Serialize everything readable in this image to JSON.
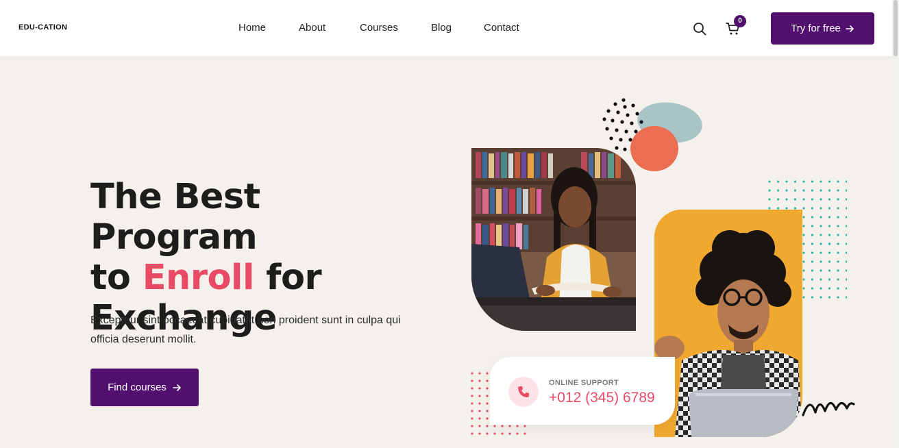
{
  "header": {
    "logo": "EDU-CATION",
    "nav": [
      "Home",
      "About",
      "Courses",
      "Blog",
      "Contact"
    ],
    "cart_count": "0",
    "cta_label": "Try for free"
  },
  "hero": {
    "title_line1": "The Best Program",
    "title_to": "to",
    "title_accent": "Enroll",
    "title_for": "for",
    "title_line3": "Exchange",
    "description": "Excepteur sint occaecat cupidatat non proident sunt in culpa qui officia deserunt mollit.",
    "cta_label": "Find courses"
  },
  "support": {
    "label": "ONLINE SUPPORT",
    "phone": "+012 (345) 6789"
  },
  "colors": {
    "primary": "#510f6e",
    "accent": "#e94b67",
    "background": "#f4f1ec"
  }
}
